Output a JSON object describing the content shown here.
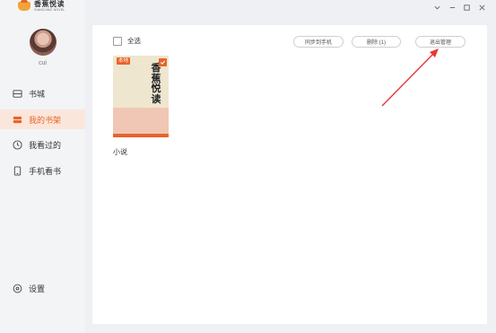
{
  "app": {
    "logo_cn": "香蕉悦读",
    "logo_en": "XIANGJIAO NOVEL"
  },
  "user": {
    "name": "cui"
  },
  "sidebar": {
    "items": [
      {
        "label": "书城",
        "icon": "bookstore-icon",
        "active": false
      },
      {
        "label": "我的书架",
        "icon": "bookshelf-icon",
        "active": true
      },
      {
        "label": "我看过的",
        "icon": "history-clock-icon",
        "active": false
      },
      {
        "label": "手机看书",
        "icon": "phone-icon",
        "active": false
      }
    ],
    "settings_label": "设置"
  },
  "window_controls": [
    "chevron-down-icon",
    "minimize-icon",
    "maximize-icon",
    "close-icon"
  ],
  "toolbar": {
    "select_all_label": "全选",
    "sync_label": "同步到手机",
    "delete_label": "删除 (1)",
    "exit_manage_label": "退出管理"
  },
  "books": [
    {
      "name": "小说",
      "cover_badge": "本地",
      "cover_title": "香蕉悦读",
      "selected": true
    }
  ],
  "colors": {
    "accent": "#e8642b",
    "sidebar_bg": "#f3f4f6",
    "active_bg": "#fbe6dc",
    "annotation_arrow": "#e53935"
  }
}
